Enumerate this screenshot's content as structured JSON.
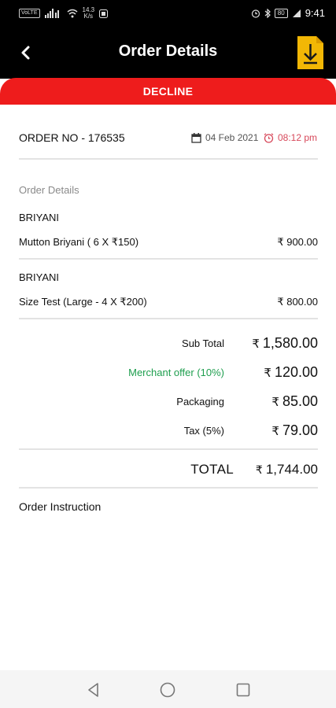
{
  "status_bar": {
    "network_badge": "VoLTE",
    "data_speed_top": "14.3",
    "data_speed_bottom": "K/s",
    "battery": "80",
    "time": "9:41"
  },
  "header": {
    "title": "Order Details"
  },
  "decline_label": "DECLINE",
  "order": {
    "number_label": "ORDER NO - 176535",
    "date": "04 Feb 2021",
    "time": "08:12 pm"
  },
  "section_title": "Order Details",
  "items": [
    {
      "category": "BRIYANI",
      "name": "Mutton Briyani ( 6 X ₹150)",
      "price": "₹ 900.00"
    },
    {
      "category": "BRIYANI",
      "name": "Size Test (Large -  4 X ₹200)",
      "price": "₹ 800.00"
    }
  ],
  "summary": {
    "currency": "₹",
    "sub_total_label": "Sub Total",
    "sub_total_value": "1,580.00",
    "offer_label": "Merchant offer (10%)",
    "offer_value": "120.00",
    "packaging_label": "Packaging",
    "packaging_value": "85.00",
    "tax_label": "Tax (5%)",
    "tax_value": "79.00",
    "total_label": "TOTAL",
    "total_value": "1,744.00"
  },
  "instruction_label": "Order Instruction",
  "colors": {
    "header_bg": "#000000",
    "decline_bg": "#ee1c1c",
    "download_icon": "#f2b705",
    "offer_text": "#1e9e4e",
    "time_text": "#d7485a"
  }
}
